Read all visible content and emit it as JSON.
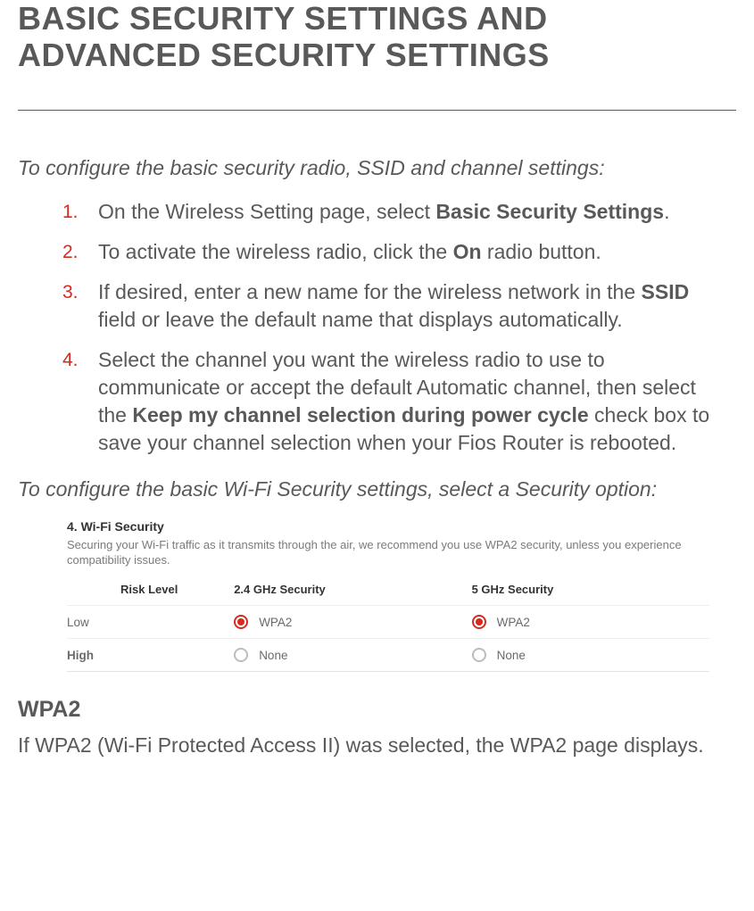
{
  "title": "BASIC SECURITY SETTINGS AND ADVANCED SECURITY SETTINGS",
  "intro1": "To configure the basic security radio, SSID and channel settings:",
  "steps": [
    {
      "num": "1.",
      "pre": "On the Wireless Setting page, select ",
      "b1": "Basic Security Settings",
      "post": "."
    },
    {
      "num": "2.",
      "pre": "To activate the wireless radio, click the ",
      "b1": "On",
      "post": " radio button."
    },
    {
      "num": "3.",
      "pre": "If desired, enter a new name for the wireless network in the ",
      "b1": "SSID",
      "post": " field or leave the default name that displays automatically."
    },
    {
      "num": "4.",
      "pre": "Select the channel you want the wireless radio to use to communicate or accept the default Automatic channel, then select the ",
      "b1": "Keep my channel selection during power cycle",
      "post": " check box to save your channel selection when your Fios Router is rebooted."
    }
  ],
  "intro2": "To configure the basic Wi-Fi Security settings, select a Security option:",
  "panel": {
    "title": "4. Wi-Fi Security",
    "desc": "Securing your Wi-Fi traffic as it transmits through the air, we recommend you use WPA2 security, unless you experience compatibility issues.",
    "headers": {
      "risk": "Risk Level",
      "c24": "2.4 GHz Security",
      "c5": "5 GHz Security"
    },
    "rows": [
      {
        "risk": "Low",
        "riskClass": "low",
        "c24": {
          "label": "WPA2",
          "checked": true
        },
        "c5": {
          "label": "WPA2",
          "checked": true
        }
      },
      {
        "risk": "High",
        "riskClass": "high",
        "c24": {
          "label": "None",
          "checked": false
        },
        "c5": {
          "label": "None",
          "checked": false
        }
      }
    ]
  },
  "wpa2_heading": "WPA2",
  "wpa2_body": "If WPA2 (Wi-Fi Protected Access II) was selected, the WPA2 page displays."
}
